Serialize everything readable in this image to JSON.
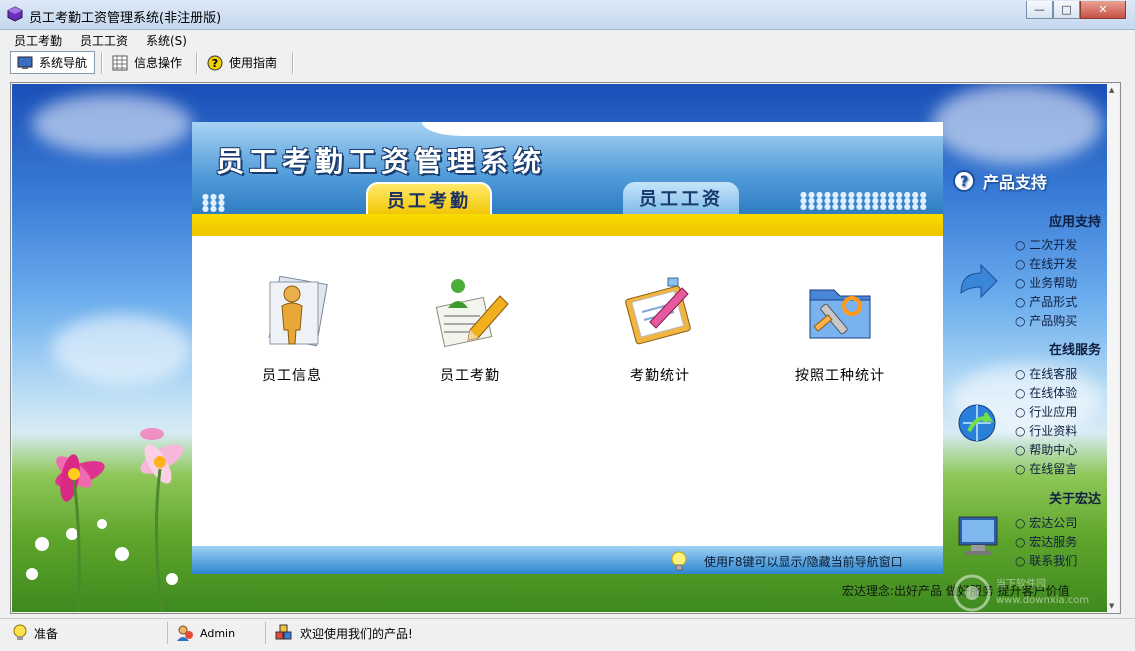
{
  "window": {
    "title": "员工考勤工资管理系统(非注册版)",
    "minimize_glyph": "—",
    "maximize_glyph": "□",
    "close_glyph": "✕"
  },
  "menu": [
    "员工考勤",
    "员工工资",
    "系统(S)"
  ],
  "toolbar": {
    "nav_label": "系统导航",
    "info_label": "信息操作",
    "guide_label": "使用指南"
  },
  "panel": {
    "title": "员工考勤工资管理系统",
    "tab_attendance": "员工考勤",
    "tab_salary": "员工工资",
    "items": [
      "员工信息",
      "员工考勤",
      "考勤统计",
      "按照工种统计"
    ],
    "footer_tip": "使用F8键可以显示/隐藏当前导航窗口"
  },
  "side": {
    "title": "产品支持",
    "sections": [
      {
        "title": "应用支持",
        "links": [
          "二次开发",
          "在线开发",
          "业务帮助",
          "产品形式",
          "产品购买"
        ]
      },
      {
        "title": "在线服务",
        "links": [
          "在线客服",
          "在线体验",
          "行业应用",
          "行业资料",
          "帮助中心",
          "在线留言"
        ]
      },
      {
        "title": "关于宏达",
        "links": [
          "宏达公司",
          "宏达服务",
          "联系我们"
        ]
      }
    ],
    "slogan": "宏达理念:出好产品 做好服务 提升客户价值",
    "watermark": "当下软件园 www.downxia.com"
  },
  "status": {
    "ready": "准备",
    "user": "Admin",
    "welcome": "欢迎使用我们的产品!"
  },
  "colors": {
    "accent_yellow": "#f0c500",
    "banner_blue": "#2f7cc2"
  }
}
